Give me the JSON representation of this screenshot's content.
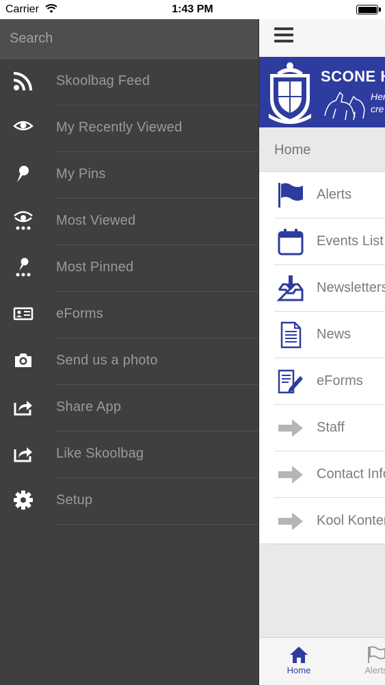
{
  "status_bar": {
    "carrier": "Carrier",
    "time": "1:43 PM"
  },
  "search": {
    "placeholder": "Search"
  },
  "side_menu": {
    "items": [
      {
        "label": "Skoolbag Feed",
        "icon": "rss-icon"
      },
      {
        "label": "My Recently Viewed",
        "icon": "eye-icon"
      },
      {
        "label": "My Pins",
        "icon": "pin-icon"
      },
      {
        "label": "Most Viewed",
        "icon": "eye-dots-icon"
      },
      {
        "label": "Most Pinned",
        "icon": "pin-dots-icon"
      },
      {
        "label": "eForms",
        "icon": "id-card-icon"
      },
      {
        "label": "Send us a photo",
        "icon": "camera-icon"
      },
      {
        "label": "Share App",
        "icon": "share-icon"
      },
      {
        "label": "Like Skoolbag",
        "icon": "share-icon"
      },
      {
        "label": "Setup",
        "icon": "gear-icon"
      }
    ]
  },
  "banner": {
    "school_name": "SCONE H",
    "tagline_1": "Her",
    "tagline_2": "cre"
  },
  "breadcrumb": {
    "label": "Home"
  },
  "home_list": {
    "items": [
      {
        "label": "Alerts",
        "icon": "flag-icon"
      },
      {
        "label": "Events List",
        "icon": "calendar-icon"
      },
      {
        "label": "Newsletters",
        "icon": "inbox-download-icon"
      },
      {
        "label": "News",
        "icon": "document-icon"
      },
      {
        "label": "eForms",
        "icon": "form-pencil-icon"
      },
      {
        "label": "Staff",
        "icon": "arrow-right-icon"
      },
      {
        "label": "Contact Info",
        "icon": "arrow-right-icon"
      },
      {
        "label": "Kool Kontent",
        "icon": "arrow-right-icon"
      }
    ]
  },
  "tab_bar": {
    "home_label": "Home",
    "alerts_label": "Alerts"
  },
  "colors": {
    "brand": "#2d3c9e",
    "menu_bg": "#3f3f41",
    "menu_text": "#9a9a9c",
    "arrow_gray": "#b5b5b7"
  }
}
